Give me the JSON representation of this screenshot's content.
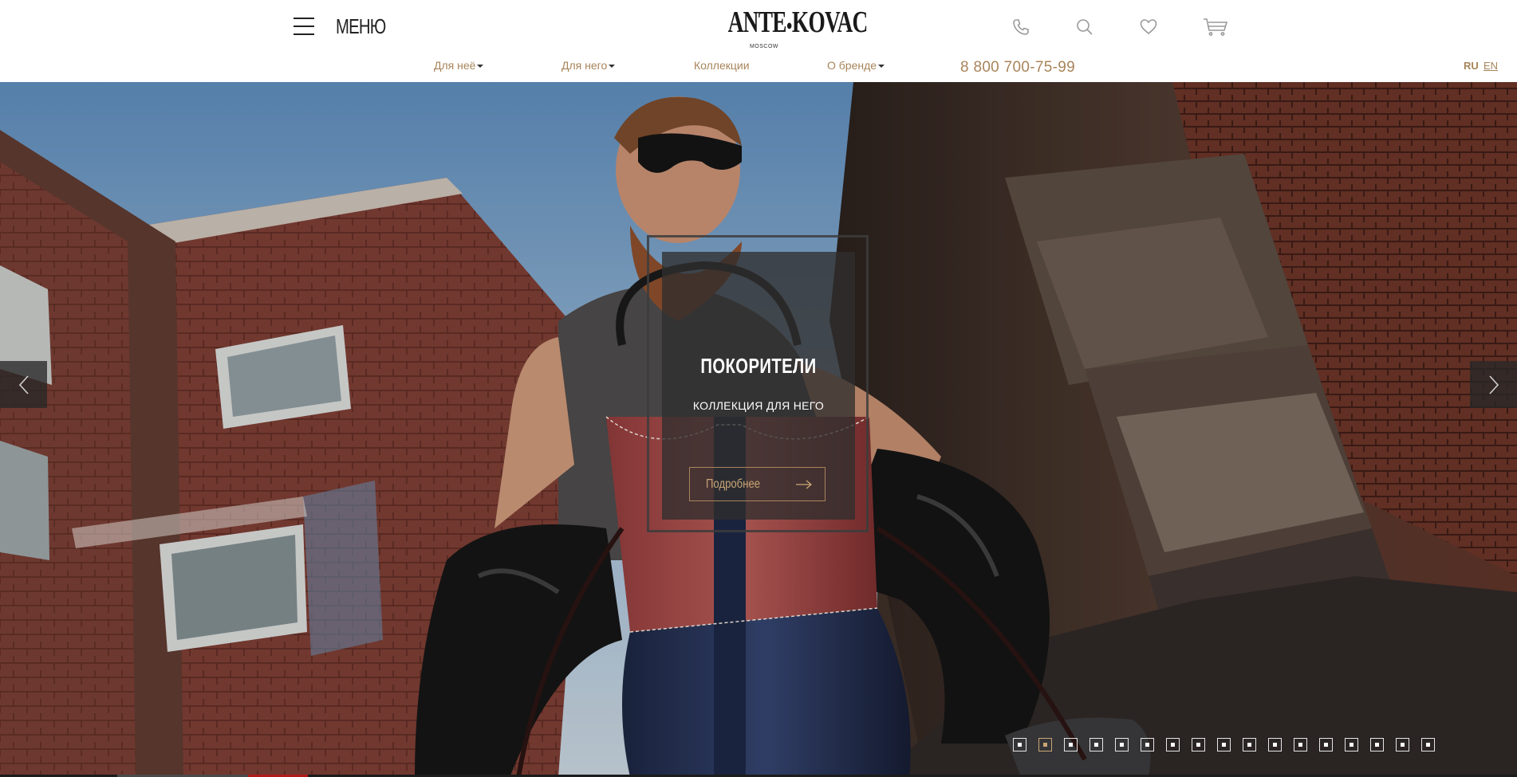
{
  "header": {
    "menu_label": "МЕНЮ",
    "logo_text": "ANTE KOVAC",
    "logo_left": "ANTE",
    "logo_right": "KOVAC",
    "logo_sub": "MOSCOW",
    "icons": [
      "phone-icon",
      "search-icon",
      "heart-icon",
      "cart-icon"
    ]
  },
  "nav": {
    "items": [
      {
        "label": "Для неё",
        "dropdown": true
      },
      {
        "label": "Для него",
        "dropdown": true
      },
      {
        "label": "Коллекции",
        "dropdown": false
      },
      {
        "label": "О бренде",
        "dropdown": true
      }
    ],
    "phone": "8 800 700-75-99",
    "languages": {
      "ru": "RU",
      "en": "EN",
      "active": "RU"
    }
  },
  "hero": {
    "title": "ПОКОРИТЕЛИ",
    "subtitle": "КОЛЛЕКЦИЯ ДЛЯ НЕГО",
    "button_label": "Подробнее",
    "slide_count": 17,
    "active_slide": 1
  },
  "colors": {
    "accent": "#a8845a",
    "accent_light": "#c9a676",
    "text_dark": "#222222",
    "icon_gray": "#9a9a9a",
    "progress_red": "#b01a1a"
  }
}
